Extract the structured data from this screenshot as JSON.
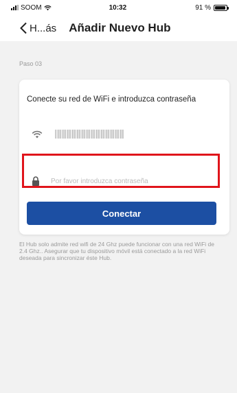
{
  "status_bar": {
    "carrier": "SOOM",
    "time": "10:32",
    "battery": "91 %",
    "battery_level": 0.91
  },
  "nav": {
    "back_label": "H...ás",
    "title": "Añadir Nuevo Hub"
  },
  "step_label": "Paso 03",
  "card": {
    "title": "Conecte su red de WiFi e introduzca contraseña",
    "network_name": "",
    "password_placeholder": "Por favor introduzca contraseña",
    "password_value": "",
    "connect_label": "Conectar"
  },
  "note": "El Hub solo admite red wifi de 24 Ghz puede funcionar con una red WiFi de 2.4 Ghz.. Asegurar que tu dispositivo móvil está conectado a la red WiFi deseada para sincronizar éste Hub.",
  "colors": {
    "primary_button": "#1c4fa3",
    "highlight_border": "#e0141b",
    "background": "#f2f2f2"
  },
  "icons": {
    "wifi": "wifi-icon",
    "lock": "lock-icon",
    "back": "chevron-left-icon"
  }
}
